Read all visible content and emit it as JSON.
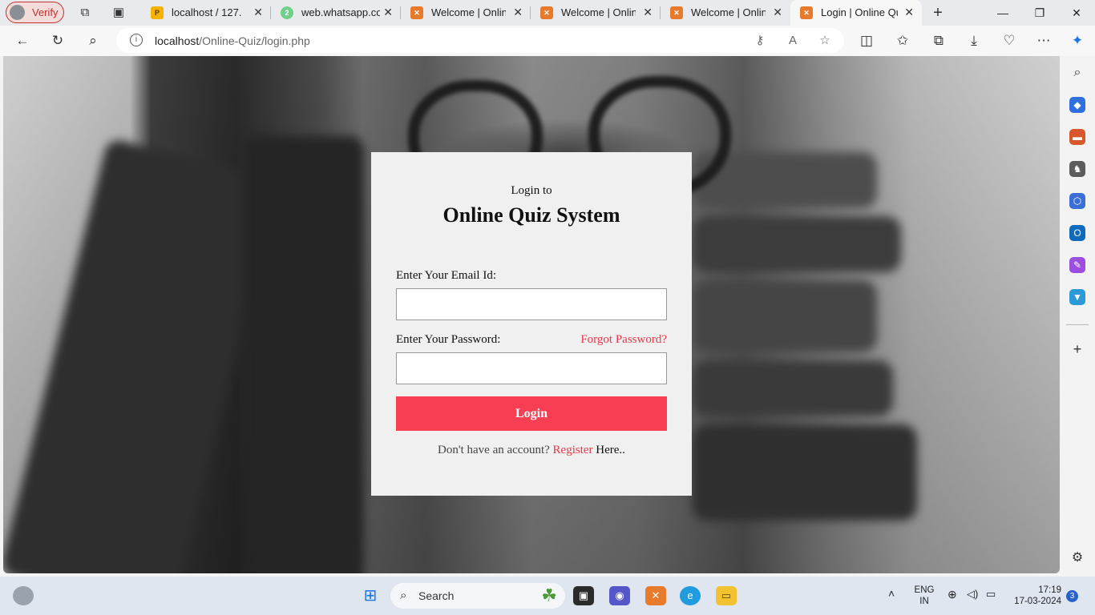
{
  "browser": {
    "profile_label": "Verify",
    "tabs": [
      {
        "title": "localhost / 127.0.0.1",
        "favicon": "phpmyadmin-icon",
        "active": false
      },
      {
        "title": "web.whatsapp.com",
        "favicon": "whatsapp-icon",
        "badge": "2",
        "active": false
      },
      {
        "title": "Welcome | Online Quiz",
        "favicon": "xampp-icon",
        "active": false
      },
      {
        "title": "Welcome | Online Quiz",
        "favicon": "xampp-icon",
        "active": false
      },
      {
        "title": "Welcome | Online Quiz",
        "favicon": "xampp-icon",
        "active": false
      },
      {
        "title": "Login | Online Quiz",
        "favicon": "xampp-icon",
        "active": true
      }
    ],
    "new_tab_label": "+",
    "address": {
      "host": "localhost",
      "path": "/Online-Quiz/login.php"
    }
  },
  "login": {
    "pre_title": "Login to",
    "title": "Online Quiz System",
    "email_label": "Enter Your Email Id:",
    "email_value": "",
    "password_label": "Enter Your Password:",
    "password_value": "",
    "forgot_link": "Forgot Password?",
    "button_label": "Login",
    "footer_prefix": "Don't have an account?",
    "register_link": "Register",
    "footer_suffix": "Here.."
  },
  "taskbar": {
    "search_placeholder": "Search",
    "language": "ENG",
    "region": "IN",
    "time": "17:19",
    "date": "17-03-2024",
    "notification_count": "3"
  },
  "colors": {
    "accent": "#f73e52",
    "link": "#e8374a",
    "card_bg": "#f0f0f0",
    "profile_red": "#c4302b"
  }
}
